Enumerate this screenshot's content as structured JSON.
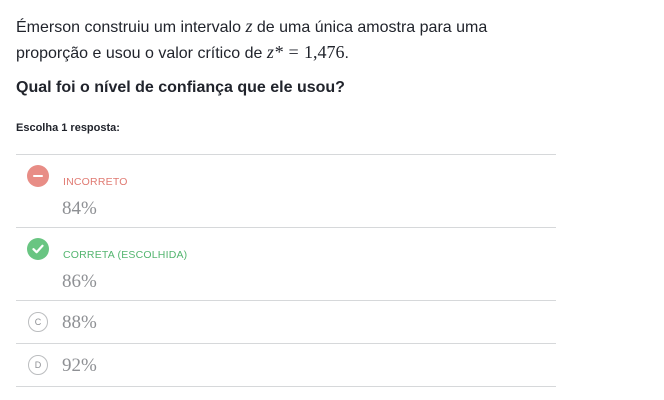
{
  "question": {
    "text_before": "Émerson construiu um intervalo ",
    "var_z": "z",
    "text_middle": " de uma única amostra para uma proporção e usou o valor crítico de ",
    "critical_lhs": "z* = ",
    "critical_value": "1,476",
    "text_after": "."
  },
  "prompt": "Qual foi o nível de confiança que ele usou?",
  "choose_label": "Escolha 1 resposta:",
  "choices": [
    {
      "status": "INCORRETO",
      "value": "84%"
    },
    {
      "status": "CORRETA (ESCOLHIDA)",
      "value": "86%"
    },
    {
      "letter": "C",
      "value": "88%"
    },
    {
      "letter": "D",
      "value": "92%"
    }
  ],
  "colors": {
    "incorrect": "#e88d86",
    "correct": "#69c582",
    "divider": "#d6d8da",
    "muted_text": "#8e9094"
  },
  "icons": {
    "incorrect": "minus-circle-icon",
    "correct": "check-circle-icon"
  }
}
